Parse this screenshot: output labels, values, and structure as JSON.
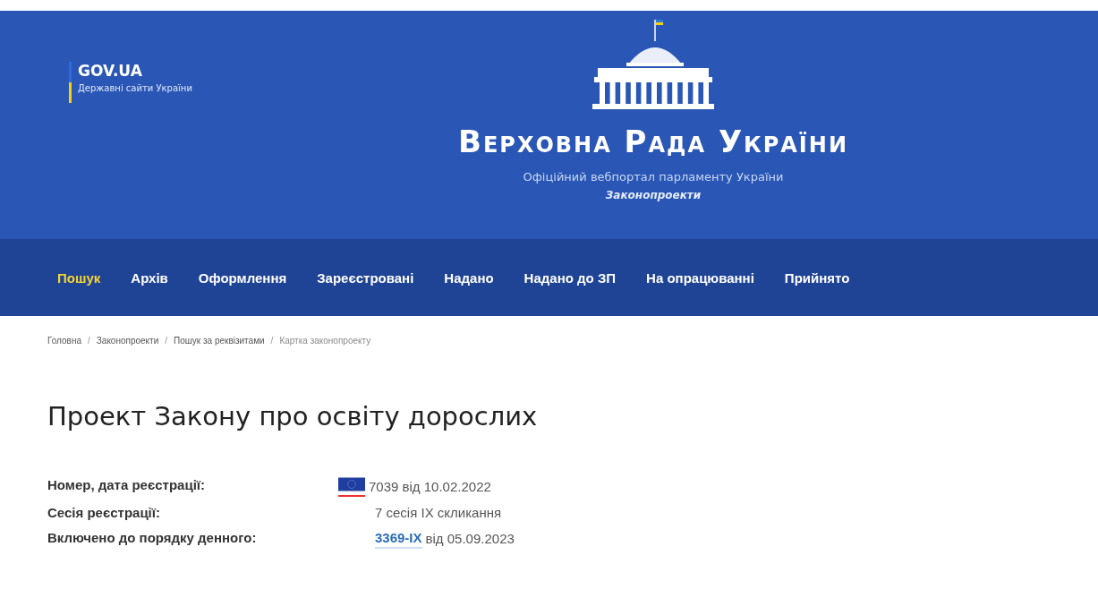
{
  "gov_badge": {
    "title": "GOV.UA",
    "subtitle": "Державні сайти України"
  },
  "site": {
    "title": "Верховна Рада України",
    "subtitle": "Офіційний вебпортал парламенту України",
    "section": "Законопроекти"
  },
  "nav": [
    {
      "label": "Пошук",
      "selected": true
    },
    {
      "label": "Архів",
      "selected": false
    },
    {
      "label": "Оформлення",
      "selected": false
    },
    {
      "label": "Зареєстровані",
      "selected": false
    },
    {
      "label": "Надано",
      "selected": false
    },
    {
      "label": "Надано до ЗП",
      "selected": false
    },
    {
      "label": "На опрацюванні",
      "selected": false
    },
    {
      "label": "Прийнято",
      "selected": false
    }
  ],
  "breadcrumbs": [
    {
      "label": "Головна",
      "selected": false
    },
    {
      "label": "Законопроекти",
      "selected": false
    },
    {
      "label": "Пошук за реквізитами",
      "selected": false
    },
    {
      "label": "Картка законопроекту",
      "selected": true
    }
  ],
  "separator": "/",
  "page_title": "Проект Закону про освіту дорослих",
  "details": [
    {
      "label": "Номер, дата реєстрації:",
      "kind": "flagged",
      "value": "7039 від 10.02.2022"
    },
    {
      "label": "Сесія реєстрації:",
      "kind": "plain",
      "value": "7 сесія IX скликання"
    },
    {
      "label": "Включено до порядку денного:",
      "kind": "link",
      "link": "3369-IX",
      "value": "від 05.09.2023"
    }
  ]
}
